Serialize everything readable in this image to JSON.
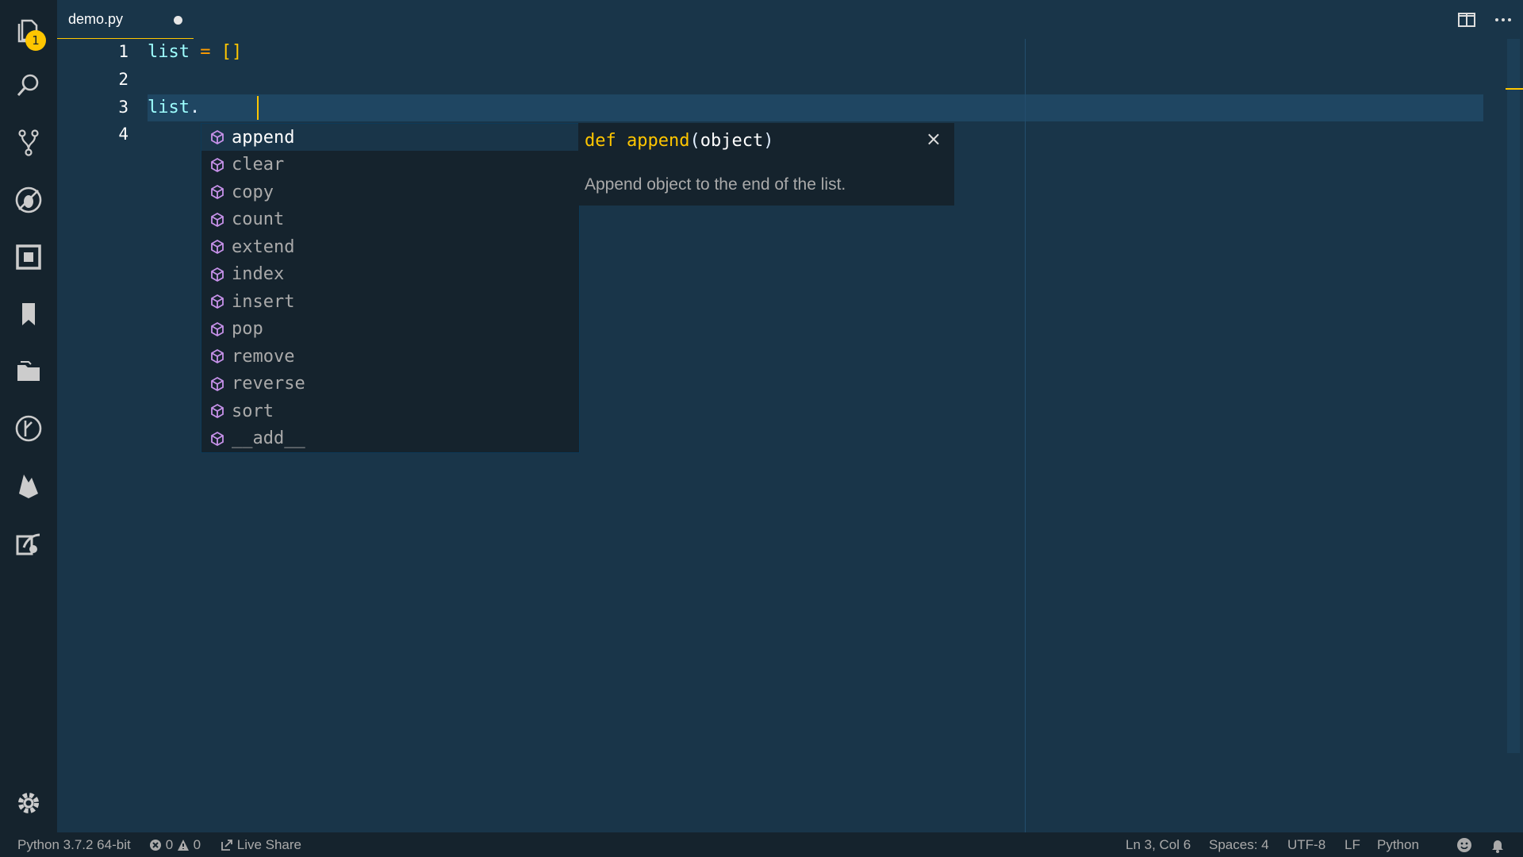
{
  "activity_bar": {
    "explorer_badge": "1"
  },
  "tab": {
    "filename": "demo.py"
  },
  "editor": {
    "line_numbers": [
      "1",
      "2",
      "3",
      "4"
    ],
    "line1": {
      "name": "list",
      "op": " = ",
      "brackets": "[]"
    },
    "line3": {
      "name": "list",
      "dot": "."
    }
  },
  "suggest": {
    "items": [
      "append",
      "clear",
      "copy",
      "count",
      "extend",
      "index",
      "insert",
      "pop",
      "remove",
      "reverse",
      "sort",
      "__add__"
    ],
    "selected_index": 0
  },
  "details": {
    "keyword": "def ",
    "func": "append",
    "open_paren": "(",
    "param": "object",
    "close_paren": ")",
    "doc": "Append object to the end of the list.",
    "close": "×"
  },
  "status": {
    "interpreter": "Python 3.7.2 64-bit",
    "errors": "0",
    "warnings": "0",
    "live_share": "Live Share",
    "position": "Ln 3, Col 6",
    "spaces": "Spaces: 4",
    "encoding": "UTF-8",
    "eol": "LF",
    "language": "Python"
  },
  "colors": {
    "background": "#193549",
    "sidebar": "#15232d",
    "accent": "#ffc600",
    "variable": "#9effff",
    "method_icon": "#c792ea"
  }
}
